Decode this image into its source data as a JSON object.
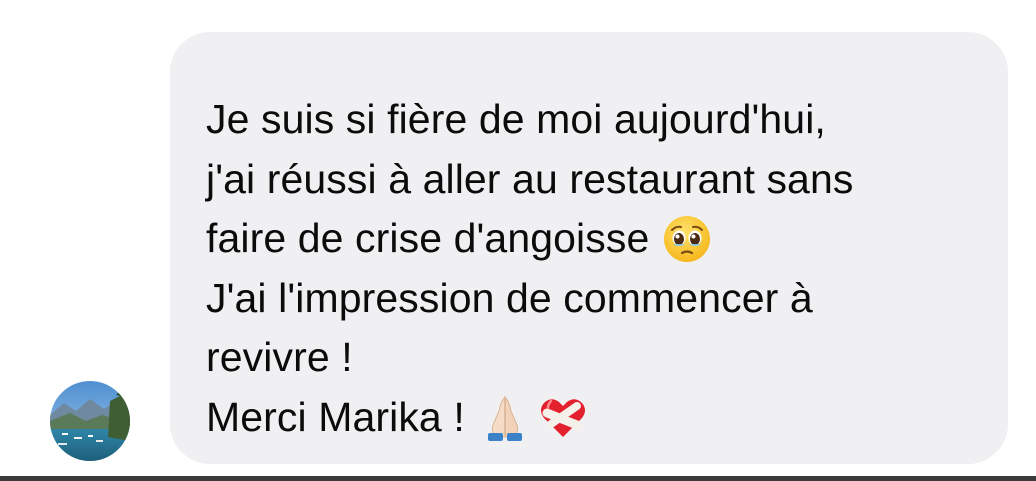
{
  "conversation": {
    "sender_avatar_icon": "avatar-lake-photo",
    "message": {
      "lines": [
        "Je suis si fière de moi aujourd'hui,",
        "j'ai réussi à aller au restaurant sans",
        "faire de crise d'angoisse",
        "J'ai l'impression de commencer à",
        "revivre !",
        "Merci Marika !"
      ],
      "emojis": {
        "line3": "pleading-face-emoji",
        "line6_first": "folded-hands-emoji",
        "line6_second": "mending-heart-emoji"
      }
    }
  },
  "colors": {
    "bubble": "#f0f0f2",
    "text": "#0b0b0b",
    "background": "#ffffff"
  }
}
